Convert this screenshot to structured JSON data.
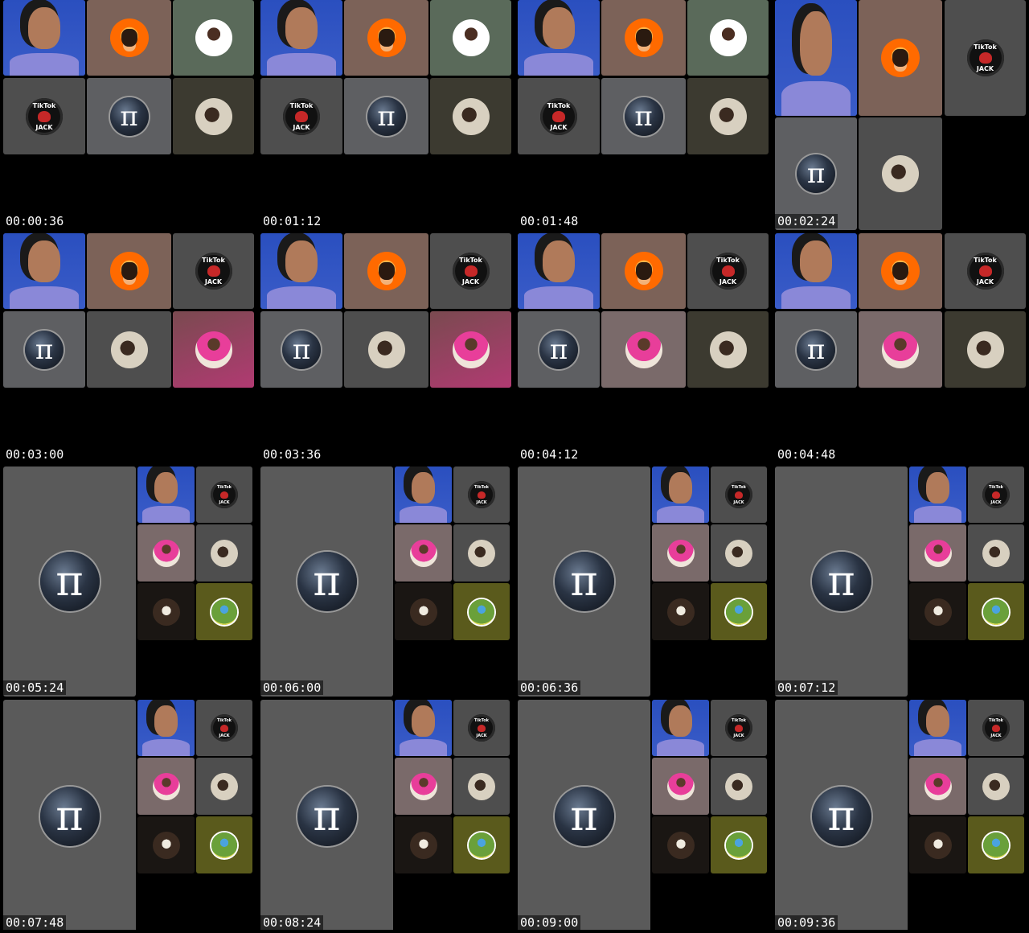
{
  "frames": [
    {
      "timestamp": "00:00:36"
    },
    {
      "timestamp": "00:01:12"
    },
    {
      "timestamp": "00:01:48"
    },
    {
      "timestamp": "00:02:24"
    },
    {
      "timestamp": "00:03:00"
    },
    {
      "timestamp": "00:03:36"
    },
    {
      "timestamp": "00:04:12"
    },
    {
      "timestamp": "00:04:48"
    },
    {
      "timestamp": "00:05:24"
    },
    {
      "timestamp": "00:06:00"
    },
    {
      "timestamp": "00:06:36"
    },
    {
      "timestamp": "00:07:12"
    },
    {
      "timestamp": "00:07:48"
    },
    {
      "timestamp": "00:08:24"
    },
    {
      "timestamp": "00:09:00"
    },
    {
      "timestamp": "00:09:36"
    }
  ],
  "tiktok": {
    "brand": "TikTok",
    "name": "JACK"
  },
  "pi_symbol": "π",
  "colors": {
    "background": "#000000",
    "timestamp_text": "#ffffff"
  }
}
